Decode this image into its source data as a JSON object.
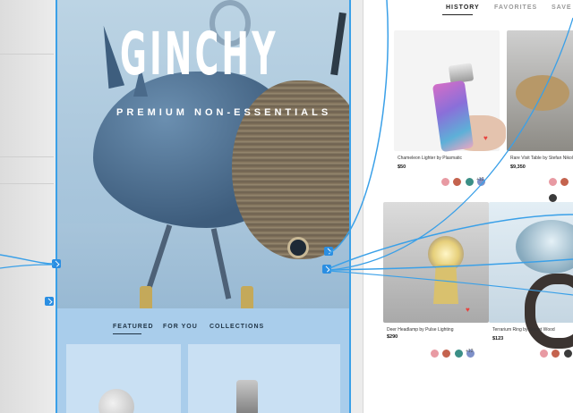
{
  "hero": {
    "title": "GINCHY",
    "tagline": "PREMIUM NON-ESSENTIALS"
  },
  "mobile_tabs": [
    "FEATURED",
    "FOR YOU",
    "COLLECTIONS"
  ],
  "shop_tabs": [
    "HISTORY",
    "FAVORITES",
    "SAVE"
  ],
  "products": [
    {
      "name": "Chameleon Lighter by Plasmatic",
      "price": "$50",
      "count": "+12"
    },
    {
      "name": "Rare Visit Table by Stefan Nikol",
      "price": "$9,350",
      "count": ""
    },
    {
      "name": "Deer Headlamp by Pulse Lighting",
      "price": "$290",
      "count": "+12"
    },
    {
      "name": "Terrarium Ring by Secret Wood",
      "price": "$123",
      "count": ""
    }
  ],
  "colors": {
    "selection_blue": "#3aa0e8",
    "accent_red": "#e8433e"
  },
  "icons": {
    "favorite": "heart-icon",
    "connector": "chevron-handle-icon"
  }
}
